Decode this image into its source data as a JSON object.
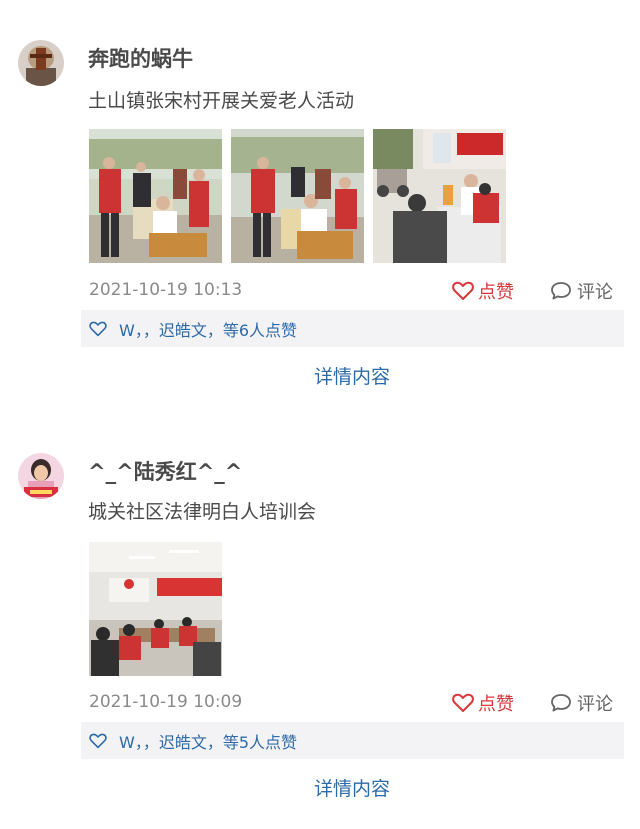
{
  "posts": [
    {
      "username": "奔跑的蜗牛",
      "text": "土山镇张宋村开展关爱老人活动",
      "photos": [
        "volunteer-photo-1",
        "volunteer-photo-2",
        "volunteer-photo-3"
      ],
      "timestamp": "2021-10-19 10:13",
      "like_label": "点赞",
      "comment_label": "评论",
      "likes_text": "W，，迟皓文，等6人点赞",
      "details_label": "详情内容"
    },
    {
      "username": "^_^陆秀红^_^",
      "text": "城关社区法律明白人培训会",
      "photos": [
        "training-meeting-photo"
      ],
      "timestamp": "2021-10-19 10:09",
      "like_label": "点赞",
      "comment_label": "评论",
      "likes_text": "W，，迟皓文，等5人点赞",
      "details_label": "详情内容"
    }
  ],
  "colors": {
    "like_red": "#d8383b",
    "link_blue": "#2d6aa8",
    "likes_bar_bg": "#f3f3f5",
    "timestamp_gray": "#8a8a8a"
  },
  "icons": {
    "like": "heart-outline-icon",
    "comment": "speech-bubble-icon",
    "likes_bar": "heart-outline-icon"
  }
}
